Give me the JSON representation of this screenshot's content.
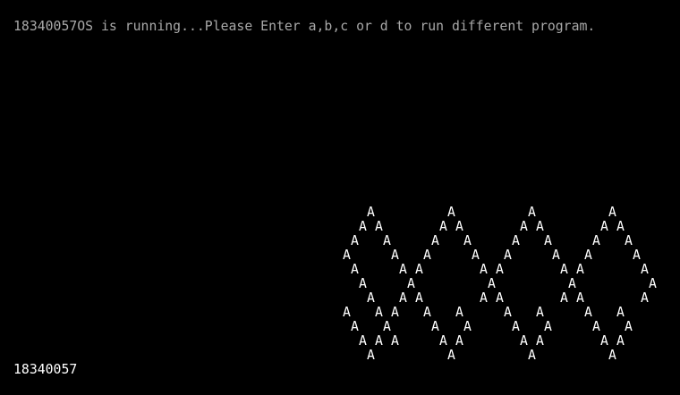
{
  "screen": {
    "background_color": "#000000",
    "status_text": "18340057OS is running...Please Enter a,b,c or d to run different program.",
    "status_color": "#a8a8a8",
    "student_id": "18340057",
    "student_id_color": "#ffffff"
  },
  "pattern": {
    "char": "A",
    "color": "#ffffff",
    "rows": [
      "   A         A         A         A",
      "  A A       A A       A A       A A",
      " A   A     A   A     A   A     A   A",
      "A     A   A     A   A     A   A     A",
      " A     A A       A A       A A       A",
      "  A     A         A         A         A",
      "   A   A A       A A       A A       A",
      "A   A A   A   A     A   A     A   A",
      " A   A     A   A     A   A     A   A",
      "  A A A     A A       A A       A A",
      "   A         A         A         A"
    ]
  }
}
